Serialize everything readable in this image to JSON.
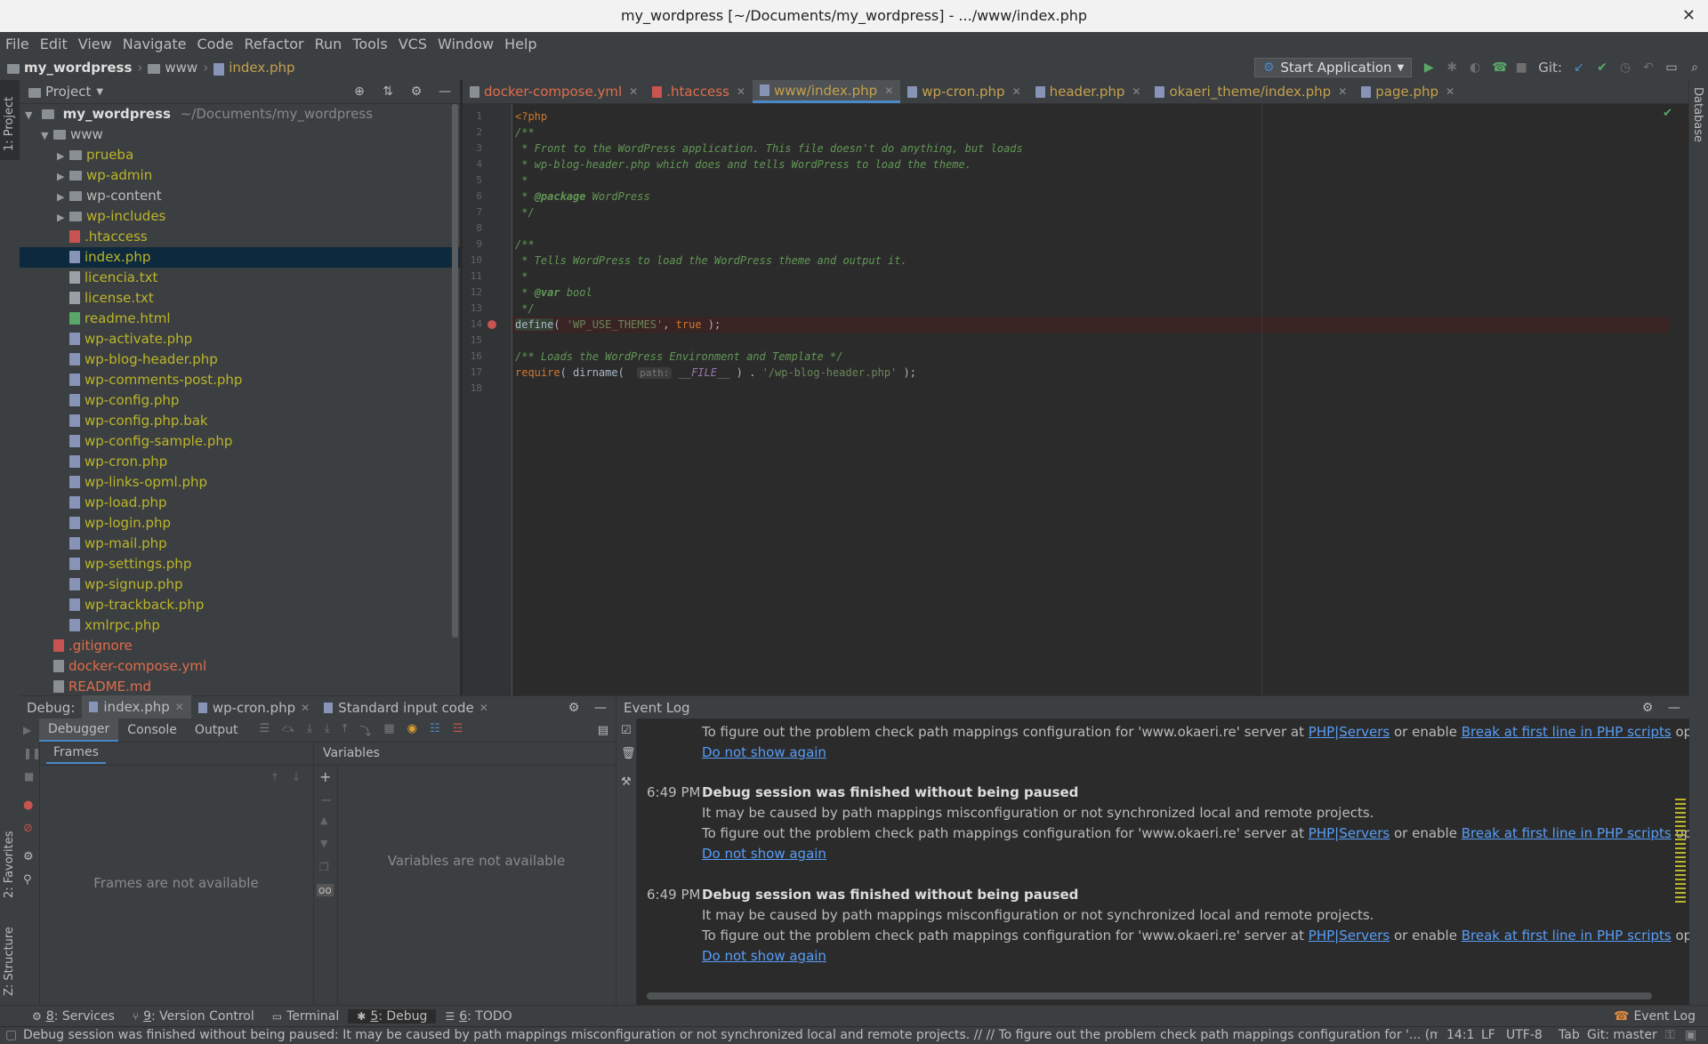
{
  "window": {
    "title": "my_wordpress [~/Documents/my_wordpress] - .../www/index.php",
    "close": "✕"
  },
  "menu": [
    "File",
    "Edit",
    "View",
    "Navigate",
    "Code",
    "Refactor",
    "Run",
    "Tools",
    "VCS",
    "Window",
    "Help"
  ],
  "breadcrumb": {
    "project": "my_wordpress",
    "folder": "www",
    "file": "index.php"
  },
  "toolbar": {
    "run_config": "Start Application",
    "git_label": "Git:"
  },
  "left_stripe": {
    "project": "1: Project",
    "favorites": "2: Favorites",
    "structure": "Z: Structure"
  },
  "right_stripe": {
    "database": "Database"
  },
  "project_panel": {
    "title": "Project",
    "root": {
      "name": "my_wordpress",
      "path": "~/Documents/my_wordpress"
    },
    "items": [
      {
        "name": "www",
        "type": "folder",
        "level": 1,
        "open": true,
        "color": "white"
      },
      {
        "name": "prueba",
        "type": "folder",
        "level": 2,
        "color": "olive"
      },
      {
        "name": "wp-admin",
        "type": "folder",
        "level": 2,
        "color": "olive"
      },
      {
        "name": "wp-content",
        "type": "folder",
        "level": 2,
        "color": "white"
      },
      {
        "name": "wp-includes",
        "type": "folder",
        "level": 2,
        "color": "olive"
      },
      {
        "name": ".htaccess",
        "type": "file",
        "level": 2,
        "color": "olive"
      },
      {
        "name": "index.php",
        "type": "file",
        "level": 2,
        "color": "olive",
        "selected": true
      },
      {
        "name": "licencia.txt",
        "type": "file",
        "level": 2,
        "color": "olive"
      },
      {
        "name": "license.txt",
        "type": "file",
        "level": 2,
        "color": "olive"
      },
      {
        "name": "readme.html",
        "type": "file",
        "level": 2,
        "color": "olive"
      },
      {
        "name": "wp-activate.php",
        "type": "file",
        "level": 2,
        "color": "olive"
      },
      {
        "name": "wp-blog-header.php",
        "type": "file",
        "level": 2,
        "color": "olive"
      },
      {
        "name": "wp-comments-post.php",
        "type": "file",
        "level": 2,
        "color": "olive"
      },
      {
        "name": "wp-config.php",
        "type": "file",
        "level": 2,
        "color": "olive"
      },
      {
        "name": "wp-config.php.bak",
        "type": "file",
        "level": 2,
        "color": "olive"
      },
      {
        "name": "wp-config-sample.php",
        "type": "file",
        "level": 2,
        "color": "olive"
      },
      {
        "name": "wp-cron.php",
        "type": "file",
        "level": 2,
        "color": "olive"
      },
      {
        "name": "wp-links-opml.php",
        "type": "file",
        "level": 2,
        "color": "olive"
      },
      {
        "name": "wp-load.php",
        "type": "file",
        "level": 2,
        "color": "olive"
      },
      {
        "name": "wp-login.php",
        "type": "file",
        "level": 2,
        "color": "olive"
      },
      {
        "name": "wp-mail.php",
        "type": "file",
        "level": 2,
        "color": "olive"
      },
      {
        "name": "wp-settings.php",
        "type": "file",
        "level": 2,
        "color": "olive"
      },
      {
        "name": "wp-signup.php",
        "type": "file",
        "level": 2,
        "color": "olive"
      },
      {
        "name": "wp-trackback.php",
        "type": "file",
        "level": 2,
        "color": "olive"
      },
      {
        "name": "xmlrpc.php",
        "type": "file",
        "level": 2,
        "color": "olive"
      },
      {
        "name": ".gitignore",
        "type": "file",
        "level": 1,
        "color": "red"
      },
      {
        "name": "docker-compose.yml",
        "type": "file",
        "level": 1,
        "color": "red"
      },
      {
        "name": "README.md",
        "type": "file",
        "level": 1,
        "color": "red"
      }
    ]
  },
  "editor_tabs": [
    {
      "label": "docker-compose.yml",
      "active": false
    },
    {
      "label": ".htaccess",
      "active": false
    },
    {
      "label": "www/index.php",
      "active": true
    },
    {
      "label": "wp-cron.php",
      "active": false
    },
    {
      "label": "header.php",
      "active": false
    },
    {
      "label": "okaeri_theme/index.php",
      "active": false
    },
    {
      "label": "page.php",
      "active": false
    }
  ],
  "code": {
    "breakpoint_line": 14,
    "lines": [
      "1",
      "2",
      "3",
      "4",
      "5",
      "6",
      "7",
      "8",
      "9",
      "10",
      "11",
      "12",
      "13",
      "14",
      "15",
      "16",
      "17",
      "18"
    ],
    "text": {
      "l1": "<?php",
      "l2": "/**",
      "l3": " * Front to the WordPress application. This file doesn't do anything, but loads",
      "l4": " * wp-blog-header.php which does and tells WordPress to load the theme.",
      "l5": " *",
      "l6a": " * ",
      "l6b": "@package",
      "l6c": " WordPress",
      "l7": " */",
      "l9": "/**",
      "l10": " * Tells WordPress to load the WordPress theme and output it.",
      "l11": " *",
      "l12a": " * ",
      "l12b": "@var",
      "l12c": " bool",
      "l13": " */",
      "l14a": "define",
      "l14b": "( ",
      "l14c": "'WP_USE_THEMES'",
      "l14d": ", ",
      "l14e": "true",
      "l14f": " );",
      "l16": "/** Loads the WordPress Environment and Template */",
      "l17a": "require",
      "l17b": "( dirname(  ",
      "l17hint": "path:",
      "l17c": " __FILE__",
      "l17d": " ) . ",
      "l17e": "'/wp-blog-header.php'",
      "l17f": " );"
    }
  },
  "debug": {
    "label": "Debug:",
    "sessions": [
      "index.php",
      "wp-cron.php",
      "Standard input code"
    ],
    "subtabs": [
      "Debugger",
      "Console",
      "Output"
    ],
    "frames_tab": "Frames",
    "variables_tab": "Variables",
    "frames_empty": "Frames are not available",
    "variables_empty": "Variables are not available"
  },
  "event_log": {
    "title": "Event Log",
    "partial_line": "To figure out the problem check path mappings configuration for 'www.okaeri.re' server at",
    "link_servers": "PHP|Servers",
    "or_enable": "or enable",
    "link_break": "Break at first line in PHP scripts",
    "option_tail": "option (from Run mer",
    "do_not_show": "Do not show again",
    "entries": [
      {
        "time": "6:49 PM",
        "title": "Debug session was finished without being paused",
        "line1": "It may be caused by path mappings misconfiguration or not synchronized local and remote projects."
      },
      {
        "time": "6:49 PM",
        "title": "Debug session was finished without being paused",
        "line1": "It may be caused by path mappings misconfiguration or not synchronized local and remote projects."
      }
    ]
  },
  "tool_tabs": [
    {
      "num": "8",
      "label": ": Services"
    },
    {
      "num": "9",
      "label": ": Version Control"
    },
    {
      "num": "",
      "label": "Terminal"
    },
    {
      "num": "5",
      "label": ": Debug",
      "active": true
    },
    {
      "num": "6",
      "label": ": TODO"
    }
  ],
  "event_log_button": "Event Log",
  "status": {
    "message": "Debug session was finished without being paused: It may be caused by path mappings misconfiguration or not synchronized local and remote projects. // // To figure out the problem check path mappings configuration for '... (moments ago)",
    "position": "14:1",
    "line_sep": "LF",
    "encoding": "UTF-8",
    "indent": "Tab",
    "git": "Git: master"
  },
  "colors": {
    "accent": "#4a88c7",
    "link": "#589df6",
    "olive": "#bbb529",
    "vcs_new": "#e06c4c",
    "selection": "#0d293e",
    "breakpoint": "#c75450"
  }
}
